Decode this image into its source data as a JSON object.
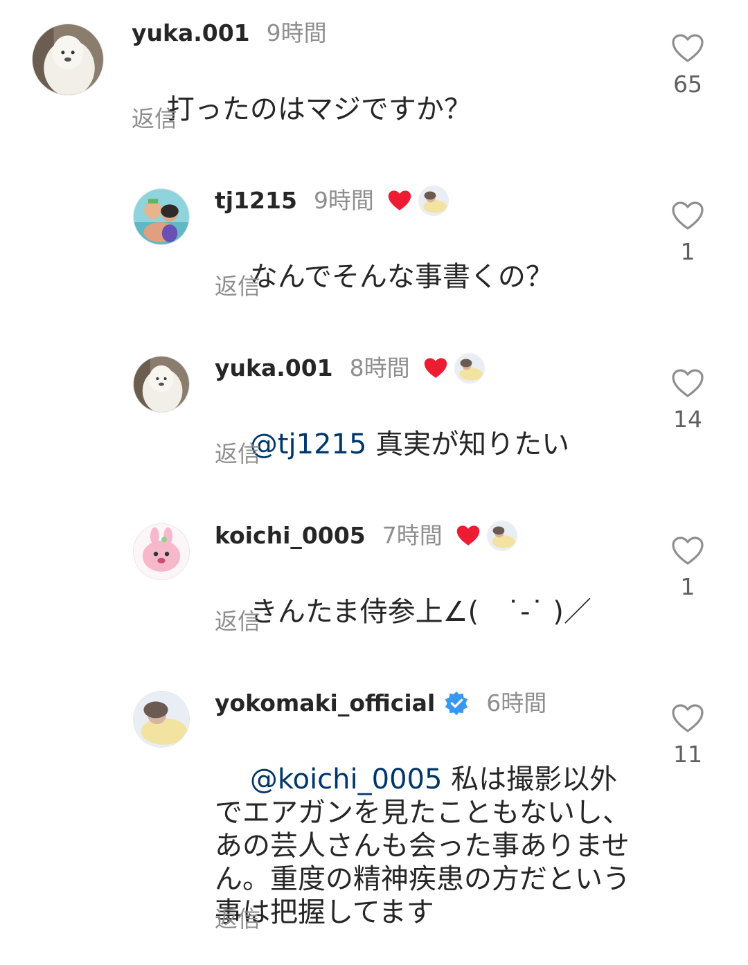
{
  "comments": [
    {
      "username": "yuka.001",
      "time": "9時間",
      "text": "打ったのはマジですか？",
      "reply_label": "返信",
      "likes": "65",
      "liked_by_author": false,
      "verified": false
    },
    {
      "username": "tj1215",
      "time": "9時間",
      "text": "なんでそんな事書くの？",
      "reply_label": "返信",
      "likes": "1",
      "liked_by_author": true,
      "verified": false
    },
    {
      "username": "yuka.001",
      "time": "8時間",
      "mention": "@tj1215",
      "text": " 真実が知りたい",
      "reply_label": "返信",
      "likes": "14",
      "liked_by_author": true,
      "verified": false
    },
    {
      "username": "koichi_0005",
      "time": "7時間",
      "text": "きんたま侍参上∠(　˙-˙ )／",
      "reply_label": "返信",
      "likes": "1",
      "liked_by_author": true,
      "verified": false
    },
    {
      "username": "yokomaki_official",
      "time": "6時間",
      "mention": "@koichi_0005",
      "text": " 私は撮影以外でエアガンを見たこともないし、あの芸人さんも会った事ありません。重度の精神疾患の方だという事は把握してます",
      "reply_label": "返信",
      "likes": "11",
      "liked_by_author": false,
      "verified": true
    }
  ],
  "colors": {
    "text": "#262626",
    "secondary": "#8e8e8e",
    "mention": "#00376b",
    "heart_red": "#ed1c33",
    "verified_blue": "#3897f0"
  },
  "icons": {
    "like": "heart-outline-icon",
    "author_like": "heart-filled-icon",
    "verified": "verified-badge-icon"
  }
}
